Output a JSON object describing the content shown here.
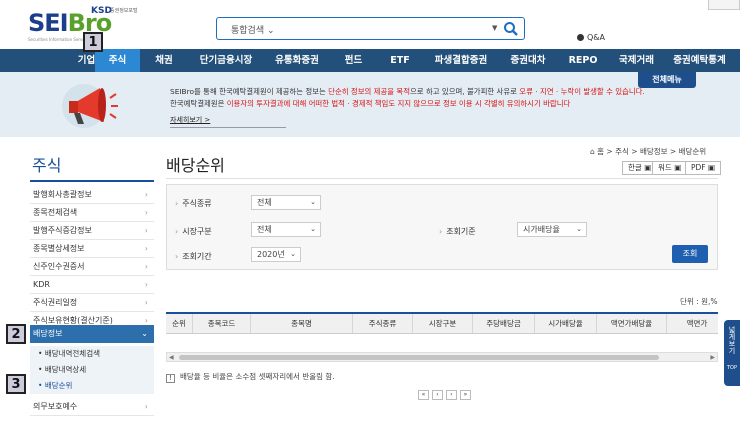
{
  "header": {
    "logo_main": "SEIBro",
    "logo_ksd": "KSD",
    "logo_ksd_sub": "증권정보포털",
    "logo_tagline": "Securities Information Service",
    "search_scope": "통합검색",
    "qna": "Q&A"
  },
  "nav": {
    "items": [
      {
        "label": "기업"
      },
      {
        "label": "주식"
      },
      {
        "label": "채권"
      },
      {
        "label": "단기금융시장"
      },
      {
        "label": "유통화증권"
      },
      {
        "label": "펀드"
      },
      {
        "label": "ETF"
      },
      {
        "label": "파생결합증권"
      },
      {
        "label": "증권대차"
      },
      {
        "label": "REPO"
      },
      {
        "label": "국제거래"
      },
      {
        "label": "증권예탁통계"
      }
    ],
    "active_index": 1,
    "all_menu": "전체메뉴"
  },
  "notice": {
    "line1_a": "SEIBro를 통해 한국예탁결제원이 제공하는 정보는 ",
    "line1_red1": "단순히 정보의 제공을 목적",
    "line1_b": "으로 하고 있으며, 불가피한 사유로 ",
    "line1_red2": "오류 · 지연 · 누락이 발생할 수 있습니다.",
    "line2_a": "한국예탁결제원은 ",
    "line2_red": "이용자의 투자결과에 대해 어떠한 법적 · 경제적 책임도 지지 않으므로 정보 이용 시 각별히 유의하시기 바랍니다",
    "more": "자세히보기 >"
  },
  "badges": [
    "1",
    "2",
    "3"
  ],
  "sidebar": {
    "title": "주식",
    "items": [
      {
        "label": "발행회사총괄정보"
      },
      {
        "label": "종목전체검색"
      },
      {
        "label": "발행주식증감정보"
      },
      {
        "label": "종목별상세정보"
      },
      {
        "label": "신주인수권증서"
      },
      {
        "label": "KDR"
      },
      {
        "label": "주식권리일정"
      },
      {
        "label": "주식보유현황(결산기준)"
      },
      {
        "label": "배당정보"
      }
    ],
    "sub_items": [
      {
        "label": "배당내역전체검색"
      },
      {
        "label": "배당내역상세"
      },
      {
        "label": "배당순위"
      }
    ],
    "after": {
      "label": "의무보호예수"
    }
  },
  "main": {
    "title": "배당순위",
    "breadcrumb": "⌂ 홈 > 주식 > 배당정보 > 배당순위",
    "export": {
      "hangul": "한글",
      "word": "워드",
      "pdf": "PDF"
    },
    "filters": {
      "stock_type_label": "주식종류",
      "stock_type_value": "전체",
      "market_label": "시장구분",
      "market_value": "전체",
      "criteria_label": "조회기준",
      "criteria_value": "시가배당율",
      "period_label": "조회기간",
      "period_value": "2020년"
    },
    "query_button": "조회",
    "unit": "단위 : 원,%",
    "columns": [
      "순위",
      "종목코드",
      "종목명",
      "주식종류",
      "시장구분",
      "주당배당금",
      "시가배당율",
      "액면가배당율",
      "액면가"
    ],
    "note": "배당율 등 비율은 소수점 셋째자리에서 반올림 함.",
    "pagination": [
      "«",
      "‹",
      "›",
      "»"
    ]
  },
  "side_tab": {
    "label": "넓게보기",
    "top": "TOP"
  },
  "colors": {
    "nav": "#22507a",
    "nav_active": "#2d88d3",
    "accent": "#1a4f9c",
    "notice_bg": "#e4edf4",
    "warn": "#d81414"
  }
}
